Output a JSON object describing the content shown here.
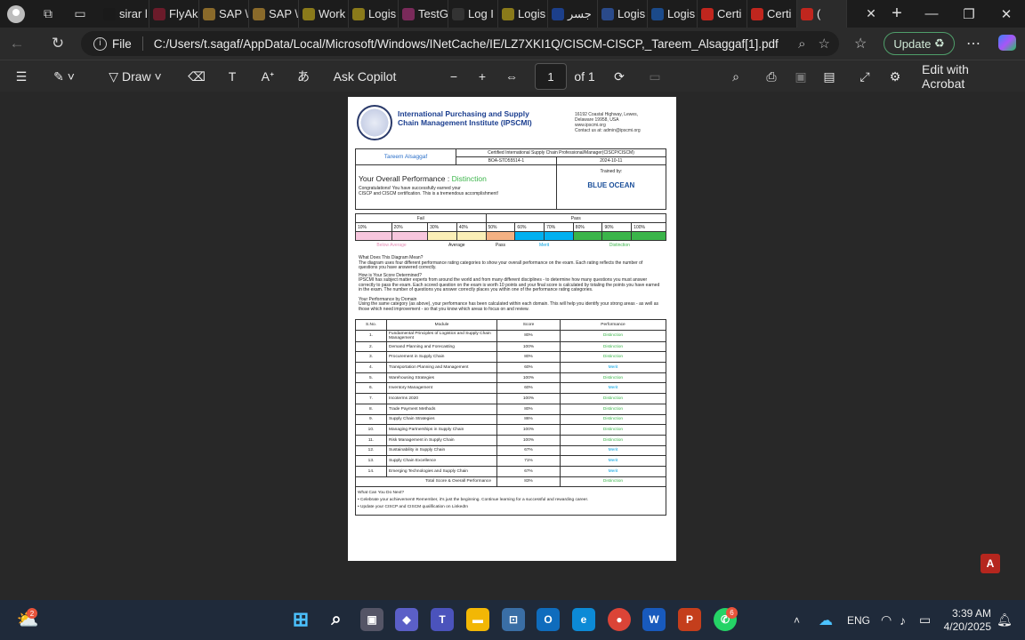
{
  "tabs": [
    {
      "label": "sirar l",
      "color": "#1a1a1a"
    },
    {
      "label": "FlyAk",
      "color": "#6b1b2a"
    },
    {
      "label": "SAP \\",
      "color": "#8a6a2a"
    },
    {
      "label": "SAP \\",
      "color": "#8a6a2a"
    },
    {
      "label": "Work",
      "color": "#8a7a1a"
    },
    {
      "label": "Logis",
      "color": "#8a7a1a"
    },
    {
      "label": "TestG",
      "color": "#7a2a5a"
    },
    {
      "label": "Log I",
      "color": "#333333"
    },
    {
      "label": "Logis",
      "color": "#8a7a1a"
    },
    {
      "label": "جسر",
      "color": "#1c3f8a"
    },
    {
      "label": "Logis",
      "color": "#2a4a8a"
    },
    {
      "label": "Logis",
      "color": "#1b4a8a"
    },
    {
      "label": "Certi",
      "color": "#c0261e"
    },
    {
      "label": "Certi",
      "color": "#c0261e"
    },
    {
      "label": "(",
      "color": "#c0261e"
    }
  ],
  "address": {
    "file_label": "File",
    "url": "C:/Users/t.sagaf/AppData/Local/Microsoft/Windows/INetCache/IE/LZ7XKI1Q/CISCM-CISCP,_Tareem_Alsaggaf[1].pdf"
  },
  "update_label": "Update",
  "pdf_toolbar": {
    "draw": "Draw",
    "ask": "Ask Copilot",
    "page": "1",
    "of": "of 1",
    "edit": "Edit with Acrobat"
  },
  "doc": {
    "org": "International Purchasing and Supply Chain Management Institute (IPSCMI)",
    "addr1": "16192 Coastal Highway, Lewes,",
    "addr2": "Delaware 19958, USA",
    "addr3": "www.ipscmi.org",
    "addr4": "Contact us at: admin@ipscmi.org",
    "name": "Tareem Alsaggaf",
    "cert": "Certified International Supply Chain Professional/Manager(CISCP/CISCM)",
    "id": "BOA-STD55514-1",
    "date": "2024-10-11",
    "trained": "Trained by:",
    "brand": "BLUE OCEAN",
    "overall": "Your Overall Performance :",
    "result": "Distinction",
    "congrats1": "Congratulations! You have successfully earned your",
    "congrats2": "CISCP and CISCM certification. This is a tremendous accomplishment!",
    "fail": "Fail",
    "pass": "Pass",
    "pcts": [
      "10%",
      "20%",
      "30%",
      "40%",
      "50%",
      "60%",
      "70%",
      "80%",
      "90%",
      "100%"
    ],
    "bands": [
      "Below Average",
      "Average",
      "Pass",
      "Merit",
      "Distinction"
    ],
    "q1": "What Does This Diagram Mean?",
    "a1": "The diagram uses four different performance rating categories to show your overall performance on the exam. Each rating reflects the number of questions you have answered correctly.",
    "q2": "How is Your Score Determined?",
    "a2": "IPSCMI has subject matter experts from around the world and from many different disciplines - to determine how many questions you must answer correctly to pass the exam. Each scored question on the exam is worth 10 points and your final score is calculated by totaling the points you have earned in the exam. The number of questions you answer correctly places you within one of the performance rating categories.",
    "q3": "Your Performance by Domain",
    "a3": "Using the same category (as above), your performance has been calculated within each domain. This will help you identify your strong areas - as well as those which need improvement - so that you know which areas to focus on and review.",
    "cols": [
      "S.No.",
      "Module",
      "Score",
      "Performance"
    ],
    "rows": [
      {
        "n": "1.",
        "m": "Fundamental Principles of Logistics and Supply Chain Management",
        "s": "80%",
        "p": "Distinction"
      },
      {
        "n": "2.",
        "m": "Demand Planning and Forecasting",
        "s": "100%",
        "p": "Distinction"
      },
      {
        "n": "3.",
        "m": "Procurement in Supply Chain",
        "s": "80%",
        "p": "Distinction"
      },
      {
        "n": "4.",
        "m": "Transportation Planning and Management",
        "s": "60%",
        "p": "Merit"
      },
      {
        "n": "5.",
        "m": "Warehousing Strategies",
        "s": "100%",
        "p": "Distinction"
      },
      {
        "n": "6.",
        "m": "Inventory Management",
        "s": "60%",
        "p": "Merit"
      },
      {
        "n": "7.",
        "m": "Incoterms 2020",
        "s": "100%",
        "p": "Distinction"
      },
      {
        "n": "8.",
        "m": "Trade Payment Methods",
        "s": "80%",
        "p": "Distinction"
      },
      {
        "n": "9.",
        "m": "Supply Chain Strategies",
        "s": "86%",
        "p": "Distinction"
      },
      {
        "n": "10.",
        "m": "Managing Partnerships in Supply Chain",
        "s": "100%",
        "p": "Distinction"
      },
      {
        "n": "11.",
        "m": "Risk Management in Supply Chain",
        "s": "100%",
        "p": "Distinction"
      },
      {
        "n": "12.",
        "m": "Sustainability in Supply Chain",
        "s": "67%",
        "p": "Merit"
      },
      {
        "n": "13.",
        "m": "Supply Chain Excellence",
        "s": "71%",
        "p": "Merit"
      },
      {
        "n": "14.",
        "m": "Emerging Technologies and Supply Chain",
        "s": "67%",
        "p": "Merit"
      }
    ],
    "total": {
      "label": "Total Score & Overall Performance",
      "s": "83%",
      "p": "Distinction"
    },
    "next_q": "What Can You Do Next?",
    "next1": "Celebrate your achievement! Remember, it's just the beginning. Continue learning for a successful and rewarding career.",
    "next2": "Update your CISCP and CISCM qualification on LinkedIn"
  },
  "taskbar": {
    "weather_badge": "2",
    "whatsapp_badge": "6",
    "lang": "ENG",
    "time": "3:39 AM",
    "date": "4/20/2025"
  }
}
